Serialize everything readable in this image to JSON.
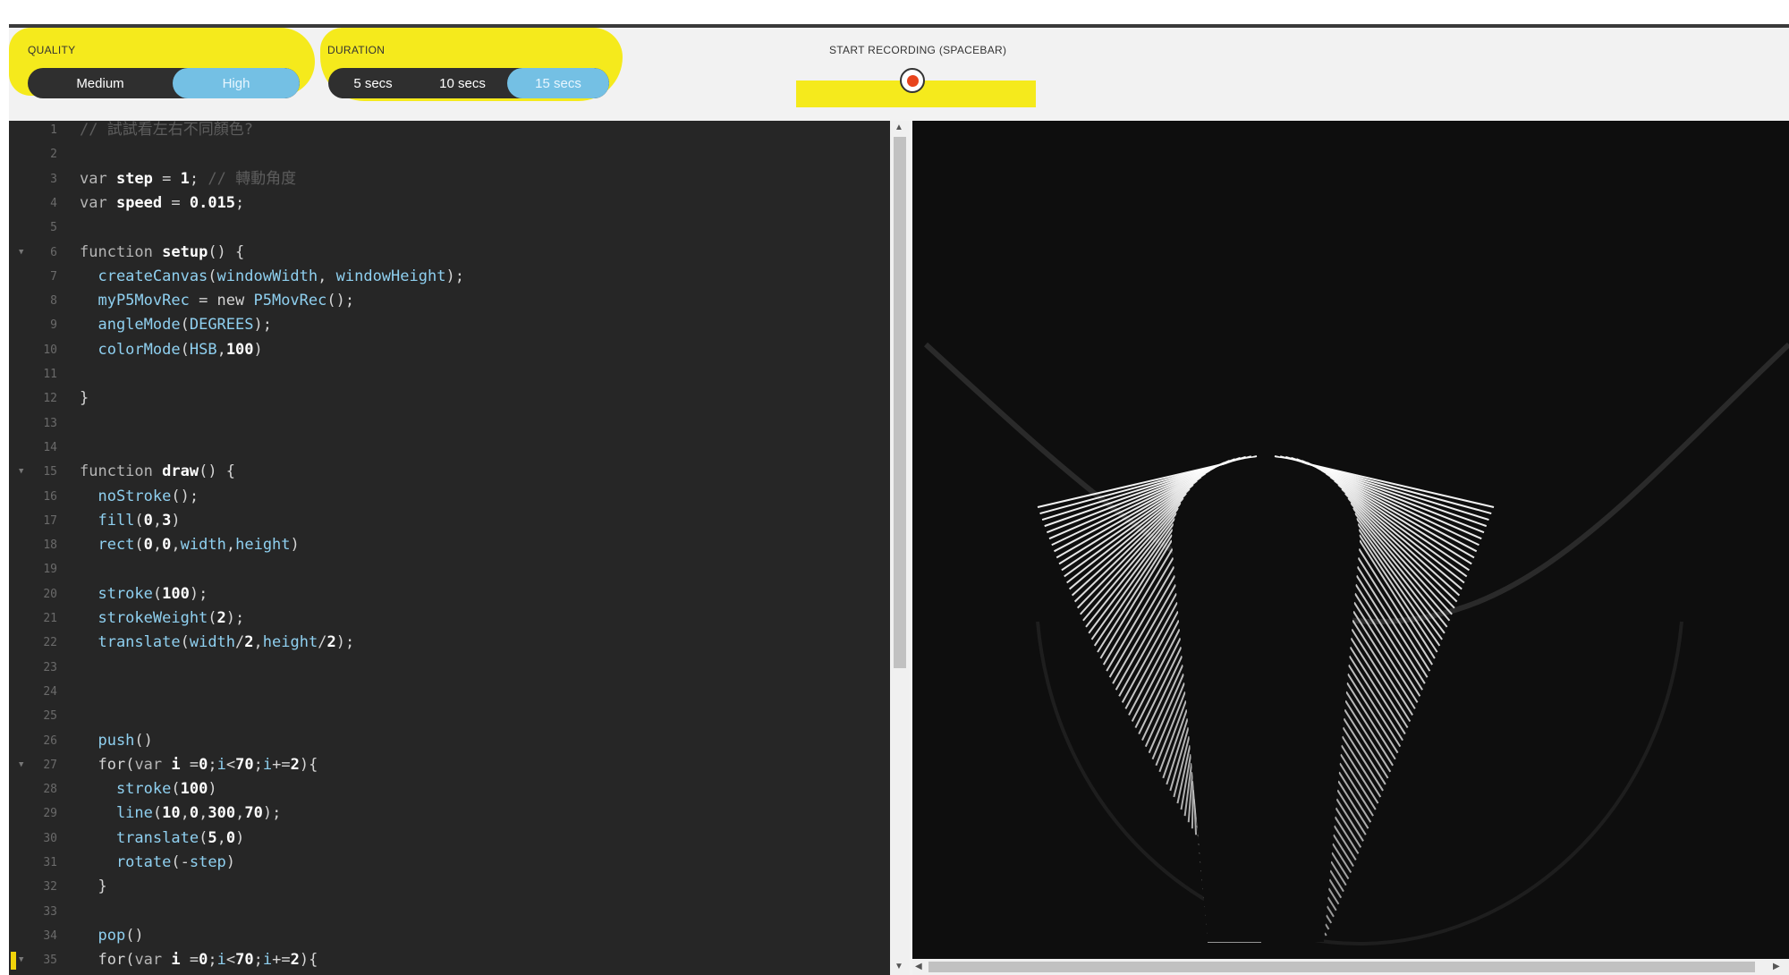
{
  "toolbar": {
    "quality": {
      "label": "QUALITY",
      "options": [
        {
          "label": "Medium",
          "selected": false
        },
        {
          "label": "High",
          "selected": true
        }
      ]
    },
    "duration": {
      "label": "DURATION",
      "options": [
        {
          "label": "5 secs",
          "selected": false
        },
        {
          "label": "10 secs",
          "selected": false
        },
        {
          "label": "15 secs",
          "selected": true
        }
      ]
    },
    "record": {
      "label": "START RECORDING (SPACEBAR)",
      "icon": "record-icon"
    }
  },
  "colors": {
    "highlight": "#f5ea1c",
    "toggle_selected": "#74c0e4",
    "record_dot": "#e8441d",
    "editor_bg": "#262626",
    "canvas_bg": "#0e0e0e"
  },
  "editor": {
    "lines": [
      {
        "n": "1",
        "tokens": [
          {
            "t": "// 試試看左右不同顏色?",
            "c": "c"
          }
        ]
      },
      {
        "n": "2",
        "tokens": []
      },
      {
        "n": "3",
        "tokens": [
          {
            "t": "var ",
            "c": "k"
          },
          {
            "t": "step",
            "c": "b"
          },
          {
            "t": " = ",
            "c": "p"
          },
          {
            "t": "1",
            "c": "b"
          },
          {
            "t": "; ",
            "c": "p"
          },
          {
            "t": "// 轉動角度",
            "c": "c"
          }
        ]
      },
      {
        "n": "4",
        "tokens": [
          {
            "t": "var ",
            "c": "k"
          },
          {
            "t": "speed",
            "c": "b"
          },
          {
            "t": " = ",
            "c": "p"
          },
          {
            "t": "0.015",
            "c": "b"
          },
          {
            "t": ";",
            "c": "p"
          }
        ]
      },
      {
        "n": "5",
        "tokens": []
      },
      {
        "n": "6",
        "fold": true,
        "tokens": [
          {
            "t": "function ",
            "c": "k"
          },
          {
            "t": "setup",
            "c": "b"
          },
          {
            "t": "() {",
            "c": "p"
          }
        ]
      },
      {
        "n": "7",
        "tokens": [
          {
            "t": "  createCanvas",
            "c": "f"
          },
          {
            "t": "(",
            "c": "p"
          },
          {
            "t": "windowWidth",
            "c": "f"
          },
          {
            "t": ", ",
            "c": "p"
          },
          {
            "t": "windowHeight",
            "c": "f"
          },
          {
            "t": ");",
            "c": "p"
          }
        ]
      },
      {
        "n": "8",
        "tokens": [
          {
            "t": "  myP5MovRec",
            "c": "f"
          },
          {
            "t": " = new ",
            "c": "p"
          },
          {
            "t": "P5MovRec",
            "c": "f"
          },
          {
            "t": "();",
            "c": "p"
          }
        ]
      },
      {
        "n": "9",
        "tokens": [
          {
            "t": "  angleMode",
            "c": "f"
          },
          {
            "t": "(",
            "c": "p"
          },
          {
            "t": "DEGREES",
            "c": "f"
          },
          {
            "t": ");",
            "c": "p"
          }
        ]
      },
      {
        "n": "10",
        "tokens": [
          {
            "t": "  colorMode",
            "c": "f"
          },
          {
            "t": "(",
            "c": "p"
          },
          {
            "t": "HSB",
            "c": "f"
          },
          {
            "t": ",",
            "c": "p"
          },
          {
            "t": "100",
            "c": "b"
          },
          {
            "t": ")",
            "c": "p"
          }
        ]
      },
      {
        "n": "11",
        "tokens": []
      },
      {
        "n": "12",
        "tokens": [
          {
            "t": "}",
            "c": "p"
          }
        ]
      },
      {
        "n": "13",
        "tokens": []
      },
      {
        "n": "14",
        "tokens": []
      },
      {
        "n": "15",
        "fold": true,
        "tokens": [
          {
            "t": "function ",
            "c": "k"
          },
          {
            "t": "draw",
            "c": "b"
          },
          {
            "t": "() {",
            "c": "p"
          }
        ]
      },
      {
        "n": "16",
        "tokens": [
          {
            "t": "  noStroke",
            "c": "f"
          },
          {
            "t": "();",
            "c": "p"
          }
        ]
      },
      {
        "n": "17",
        "tokens": [
          {
            "t": "  fill",
            "c": "f"
          },
          {
            "t": "(",
            "c": "p"
          },
          {
            "t": "0",
            "c": "b"
          },
          {
            "t": ",",
            "c": "p"
          },
          {
            "t": "3",
            "c": "b"
          },
          {
            "t": ")",
            "c": "p"
          }
        ]
      },
      {
        "n": "18",
        "tokens": [
          {
            "t": "  rect",
            "c": "f"
          },
          {
            "t": "(",
            "c": "p"
          },
          {
            "t": "0",
            "c": "b"
          },
          {
            "t": ",",
            "c": "p"
          },
          {
            "t": "0",
            "c": "b"
          },
          {
            "t": ",",
            "c": "p"
          },
          {
            "t": "width",
            "c": "f"
          },
          {
            "t": ",",
            "c": "p"
          },
          {
            "t": "height",
            "c": "f"
          },
          {
            "t": ")",
            "c": "p"
          }
        ]
      },
      {
        "n": "19",
        "tokens": []
      },
      {
        "n": "20",
        "tokens": [
          {
            "t": "  stroke",
            "c": "f"
          },
          {
            "t": "(",
            "c": "p"
          },
          {
            "t": "100",
            "c": "b"
          },
          {
            "t": ");",
            "c": "p"
          }
        ]
      },
      {
        "n": "21",
        "tokens": [
          {
            "t": "  strokeWeight",
            "c": "f"
          },
          {
            "t": "(",
            "c": "p"
          },
          {
            "t": "2",
            "c": "b"
          },
          {
            "t": ");",
            "c": "p"
          }
        ]
      },
      {
        "n": "22",
        "tokens": [
          {
            "t": "  translate",
            "c": "f"
          },
          {
            "t": "(",
            "c": "p"
          },
          {
            "t": "width",
            "c": "f"
          },
          {
            "t": "/",
            "c": "p"
          },
          {
            "t": "2",
            "c": "b"
          },
          {
            "t": ",",
            "c": "p"
          },
          {
            "t": "height",
            "c": "f"
          },
          {
            "t": "/",
            "c": "p"
          },
          {
            "t": "2",
            "c": "b"
          },
          {
            "t": ");",
            "c": "p"
          }
        ]
      },
      {
        "n": "23",
        "tokens": []
      },
      {
        "n": "24",
        "tokens": []
      },
      {
        "n": "25",
        "tokens": []
      },
      {
        "n": "26",
        "tokens": [
          {
            "t": "  push",
            "c": "f"
          },
          {
            "t": "()",
            "c": "p"
          }
        ]
      },
      {
        "n": "27",
        "fold": true,
        "tokens": [
          {
            "t": "  for",
            "c": "p"
          },
          {
            "t": "(",
            "c": "p"
          },
          {
            "t": "var ",
            "c": "k"
          },
          {
            "t": "i",
            "c": "b"
          },
          {
            "t": " =",
            "c": "p"
          },
          {
            "t": "0",
            "c": "b"
          },
          {
            "t": ";",
            "c": "p"
          },
          {
            "t": "i",
            "c": "f"
          },
          {
            "t": "<",
            "c": "p"
          },
          {
            "t": "70",
            "c": "b"
          },
          {
            "t": ";",
            "c": "p"
          },
          {
            "t": "i",
            "c": "f"
          },
          {
            "t": "+=",
            "c": "p"
          },
          {
            "t": "2",
            "c": "b"
          },
          {
            "t": "){",
            "c": "p"
          }
        ]
      },
      {
        "n": "28",
        "tokens": [
          {
            "t": "    stroke",
            "c": "f"
          },
          {
            "t": "(",
            "c": "p"
          },
          {
            "t": "100",
            "c": "b"
          },
          {
            "t": ")",
            "c": "p"
          }
        ]
      },
      {
        "n": "29",
        "tokens": [
          {
            "t": "    line",
            "c": "f"
          },
          {
            "t": "(",
            "c": "p"
          },
          {
            "t": "10",
            "c": "b"
          },
          {
            "t": ",",
            "c": "p"
          },
          {
            "t": "0",
            "c": "b"
          },
          {
            "t": ",",
            "c": "p"
          },
          {
            "t": "300",
            "c": "b"
          },
          {
            "t": ",",
            "c": "p"
          },
          {
            "t": "70",
            "c": "b"
          },
          {
            "t": ");",
            "c": "p"
          }
        ]
      },
      {
        "n": "30",
        "tokens": [
          {
            "t": "    translate",
            "c": "f"
          },
          {
            "t": "(",
            "c": "p"
          },
          {
            "t": "5",
            "c": "b"
          },
          {
            "t": ",",
            "c": "p"
          },
          {
            "t": "0",
            "c": "b"
          },
          {
            "t": ")",
            "c": "p"
          }
        ]
      },
      {
        "n": "31",
        "tokens": [
          {
            "t": "    rotate",
            "c": "f"
          },
          {
            "t": "(-",
            "c": "p"
          },
          {
            "t": "step",
            "c": "f"
          },
          {
            "t": ")",
            "c": "p"
          }
        ]
      },
      {
        "n": "32",
        "tokens": [
          {
            "t": "  }",
            "c": "p"
          }
        ]
      },
      {
        "n": "33",
        "tokens": []
      },
      {
        "n": "34",
        "tokens": [
          {
            "t": "  pop",
            "c": "f"
          },
          {
            "t": "()",
            "c": "p"
          }
        ]
      },
      {
        "n": "35",
        "fold": true,
        "marker": true,
        "tokens": [
          {
            "t": "  for",
            "c": "p"
          },
          {
            "t": "(",
            "c": "p"
          },
          {
            "t": "var ",
            "c": "k"
          },
          {
            "t": "i",
            "c": "b"
          },
          {
            "t": " =",
            "c": "p"
          },
          {
            "t": "0",
            "c": "b"
          },
          {
            "t": ";",
            "c": "p"
          },
          {
            "t": "i",
            "c": "f"
          },
          {
            "t": "<",
            "c": "p"
          },
          {
            "t": "70",
            "c": "b"
          },
          {
            "t": ";",
            "c": "p"
          },
          {
            "t": "i",
            "c": "f"
          },
          {
            "t": "+=",
            "c": "p"
          },
          {
            "t": "2",
            "c": "b"
          },
          {
            "t": "){",
            "c": "p"
          }
        ]
      }
    ]
  }
}
